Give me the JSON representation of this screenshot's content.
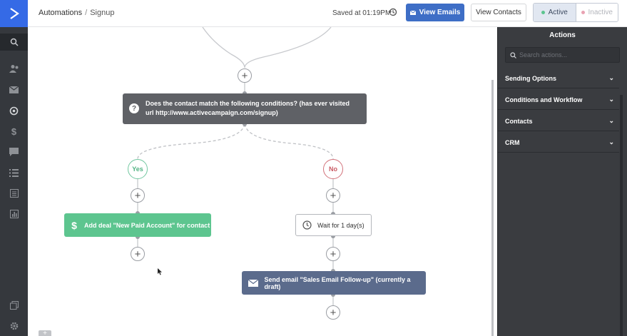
{
  "nav": {
    "items": [
      "search-icon",
      "contacts-icon",
      "campaigns-icon",
      "automations-icon",
      "deals-icon",
      "conversations-icon",
      "lists-icon",
      "forms-icon",
      "reports-icon",
      "apps-icon",
      "settings-icon"
    ]
  },
  "header": {
    "breadcrumb_root": "Automations",
    "breadcrumb_separator": "/",
    "breadcrumb_current": "Signup",
    "saved_text": "Saved at 01:19PM",
    "view_emails_label": "View Emails",
    "view_contacts_label": "View Contacts",
    "status_active": "Active",
    "status_inactive": "Inactive"
  },
  "workflow": {
    "condition_text": "Does the contact match the following conditions? (has ever visited url http://www.activecampaign.com/signup)",
    "yes_label": "Yes",
    "no_label": "No",
    "yes_action": "Add deal \"New Paid Account\" for contact",
    "wait_action": "Wait for 1 day(s)",
    "email_action": "Send email \"Sales Email Follow-up\" (currently a draft)",
    "add_symbol": "+"
  },
  "panel": {
    "title": "Actions",
    "search_placeholder": "Search actions...",
    "sections": [
      "Sending Options",
      "Conditions and Workflow",
      "Contacts",
      "CRM"
    ]
  },
  "colors": {
    "brand": "#356ae6",
    "primary_button": "#3e6ec6",
    "yes": "#5dc58f",
    "no": "#d2727a",
    "condition": "#5f6166",
    "email": "#5b6b8c"
  }
}
